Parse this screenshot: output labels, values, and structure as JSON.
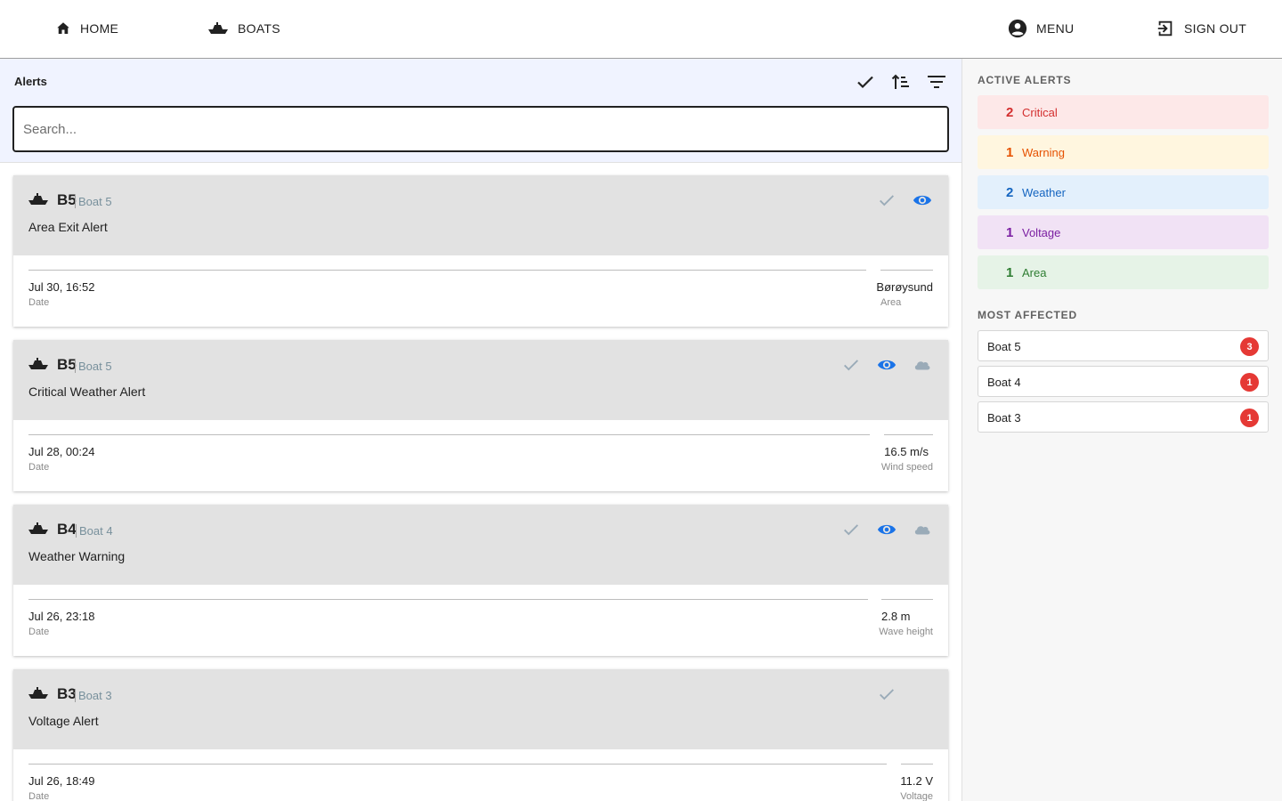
{
  "nav": {
    "home": "HOME",
    "boats": "BOATS",
    "menu": "MENU",
    "sign_out": "SIGN OUT"
  },
  "alerts_panel": {
    "title": "Alerts",
    "search_placeholder": "Search...",
    "toolbar_icons": [
      "check-icon",
      "sort-ascending-icon",
      "filter-icon"
    ]
  },
  "alerts": [
    {
      "boat_code": "B5",
      "boat_name": "Boat 5",
      "title": "Area Exit Alert",
      "date": "Jul 30, 16:52",
      "date_label": "Date",
      "metric_value": "Børøysund",
      "metric_label": "Area",
      "actions": [
        "check-icon",
        "eye-icon"
      ]
    },
    {
      "boat_code": "B5",
      "boat_name": "Boat 5",
      "title": "Critical Weather Alert",
      "date": "Jul 28, 00:24",
      "date_label": "Date",
      "metric_value": "16.5 m/s",
      "metric_label": "Wind speed",
      "actions": [
        "check-icon",
        "eye-icon",
        "cloud-icon"
      ]
    },
    {
      "boat_code": "B4",
      "boat_name": "Boat 4",
      "title": "Weather Warning",
      "date": "Jul 26, 23:18",
      "date_label": "Date",
      "metric_value": "2.8 m",
      "metric_label": "Wave height",
      "actions": [
        "check-icon",
        "eye-icon",
        "cloud-icon"
      ]
    },
    {
      "boat_code": "B3",
      "boat_name": "Boat 3",
      "title": "Voltage Alert",
      "date": "Jul 26, 18:49",
      "date_label": "Date",
      "metric_value": "11.2 V",
      "metric_label": "Voltage",
      "actions": [
        "check-icon"
      ]
    }
  ],
  "sidebar": {
    "active_heading": "ACTIVE ALERTS",
    "categories": [
      {
        "count": "2",
        "label": "Critical",
        "bg": "#fde8e8",
        "color": "#d32f2f"
      },
      {
        "count": "1",
        "label": "Warning",
        "bg": "#fff6df",
        "color": "#e65100"
      },
      {
        "count": "2",
        "label": "Weather",
        "bg": "#e3f0fc",
        "color": "#1565c0"
      },
      {
        "count": "1",
        "label": "Voltage",
        "bg": "#f1e2f5",
        "color": "#7b1fa2"
      },
      {
        "count": "1",
        "label": "Area",
        "bg": "#e6f3e7",
        "color": "#2e7d32"
      }
    ],
    "affected_heading": "MOST AFFECTED",
    "affected": [
      {
        "name": "Boat 5",
        "count": "3"
      },
      {
        "name": "Boat 4",
        "count": "1"
      },
      {
        "name": "Boat 3",
        "count": "1"
      }
    ]
  },
  "colors": {
    "accent_blue": "#1a73e8",
    "muted_icon": "#9aabb8",
    "badge_red": "#e53935",
    "header_bg": "#f0f3ff",
    "card_header_bg": "#e2e2e2"
  }
}
